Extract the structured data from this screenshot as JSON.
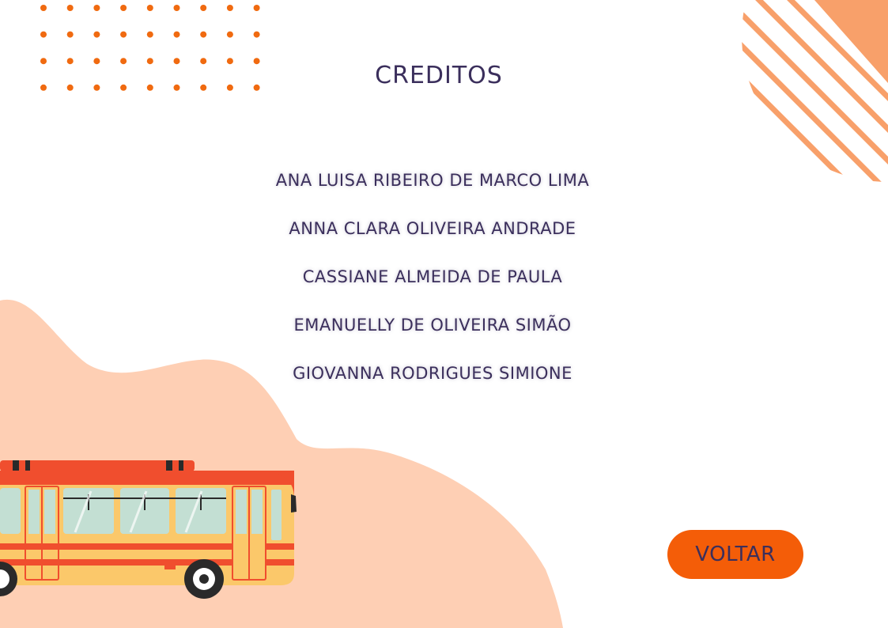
{
  "title": "CREDITOS",
  "credits": [
    "ANA LUISA RIBEIRO DE MARCO LIMA",
    "ANNA CLARA OLIVEIRA ANDRADE",
    "CASSIANE ALMEIDA DE PAULA",
    "EMANUELLY DE OLIVEIRA SIMÃO",
    "GIOVANNA RODRIGUES SIMIONE"
  ],
  "back_button": "VOLTAR",
  "colors": {
    "accent": "#f45d08",
    "text": "#3b2f5c",
    "blob": "#fecfb4",
    "stripes": "#f8a06a",
    "dots": "#f06a10"
  }
}
